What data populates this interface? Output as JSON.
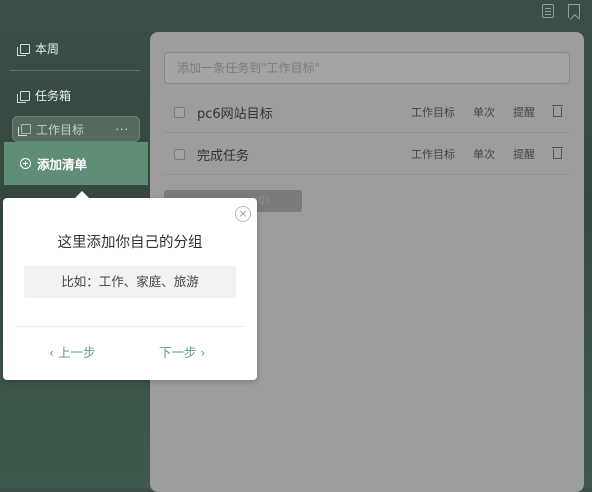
{
  "topbar": {
    "icons": [
      "list-icon",
      "bookmark-icon"
    ]
  },
  "sidebar": {
    "items": [
      {
        "label": "本周",
        "icon": "copy-icon"
      },
      {
        "label": "任务箱",
        "icon": "copy-icon"
      },
      {
        "label": "工作目标",
        "icon": "copy-icon",
        "more": "···"
      }
    ],
    "add_list_label": "添加清单"
  },
  "main": {
    "input_placeholder": "添加一条任务到\"工作目标\"",
    "tasks": [
      {
        "title": "pc6网站目标",
        "list": "工作目标",
        "repeat": "单次",
        "remind": "提醒"
      },
      {
        "title": "完成任务",
        "list": "工作目标",
        "repeat": "单次",
        "remind": "提醒"
      }
    ],
    "completed_label": "(0)"
  },
  "guide": {
    "close": "×",
    "title": "这里添加你自己的分组",
    "example": "比如：工作、家庭、旅游",
    "prev": "‹ 上一步",
    "next": "下一步 ›"
  },
  "colors": {
    "accent": "#5f8e77",
    "link": "#5e9b7d",
    "sidebar_bg": "#3c4f48"
  }
}
